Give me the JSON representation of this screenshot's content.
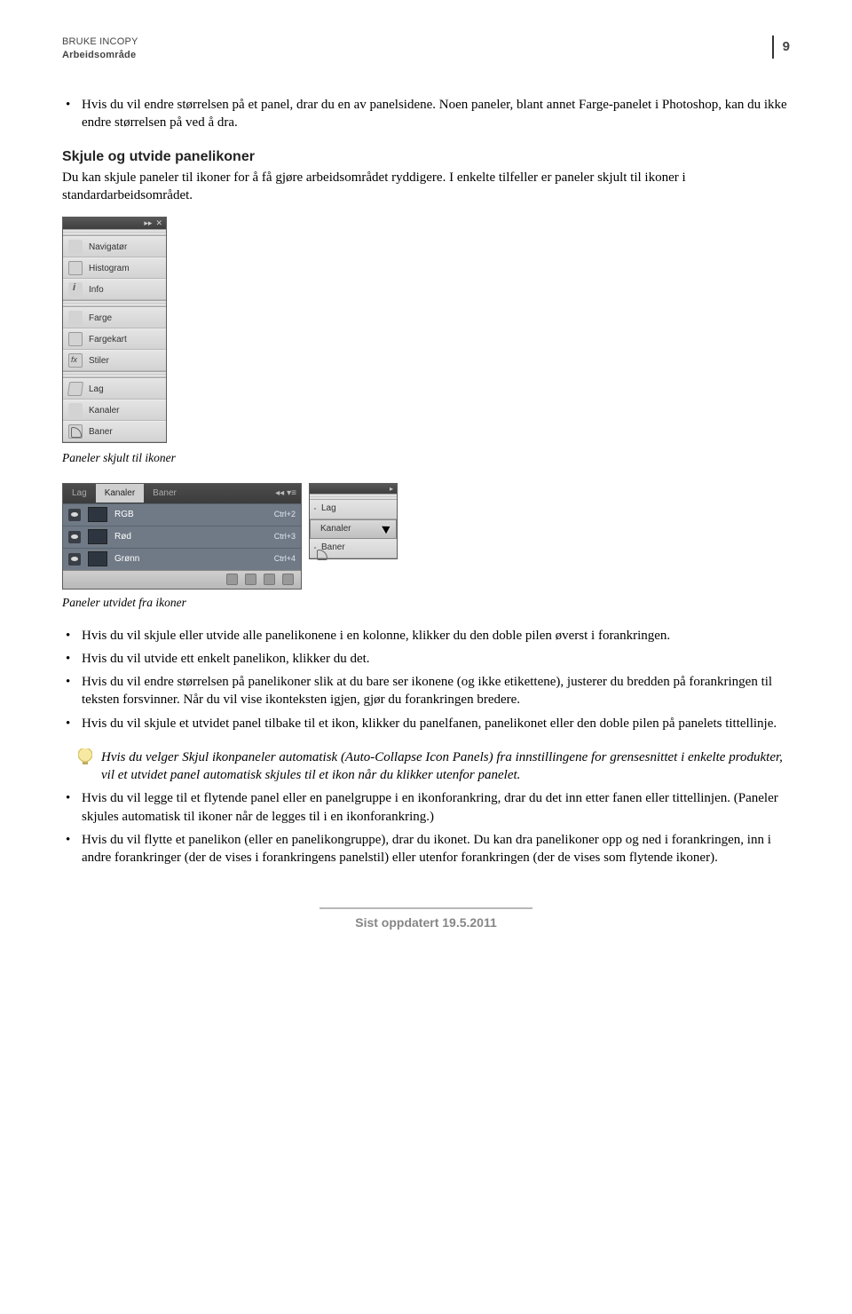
{
  "header": {
    "line1": "BRUKE INCOPY",
    "line2": "Arbeidsområde",
    "page_number": "9"
  },
  "intro_bullet": "Hvis du vil endre størrelsen på et panel, drar du en av panelsidene. Noen paneler, blant annet Farge-panelet i Photoshop, kan du ikke endre størrelsen på ved å dra.",
  "section1": {
    "heading": "Skjule og utvide panelikoner",
    "body": "Du kan skjule paneler til ikoner for å få gjøre arbeidsområdet ryddigere. I enkelte tilfeller er paneler skjult til ikoner i standardarbeidsområdet."
  },
  "panel_dock": {
    "groups": [
      [
        {
          "icon": "ic-nav",
          "name": "navigator-icon",
          "label": "Navigatør"
        },
        {
          "icon": "ic-hist",
          "name": "histogram-icon",
          "label": "Histogram"
        },
        {
          "icon": "ic-info",
          "name": "info-icon",
          "label": "Info"
        }
      ],
      [
        {
          "icon": "ic-color",
          "name": "color-icon",
          "label": "Farge"
        },
        {
          "icon": "ic-swatch",
          "name": "swatches-icon",
          "label": "Fargekart"
        },
        {
          "icon": "ic-styles",
          "name": "styles-icon",
          "label": "Stiler"
        }
      ],
      [
        {
          "icon": "ic-layers",
          "name": "layers-icon",
          "label": "Lag"
        },
        {
          "icon": "ic-channels",
          "name": "channels-icon",
          "label": "Kanaler"
        },
        {
          "icon": "ic-paths",
          "name": "paths-icon",
          "label": "Baner"
        }
      ]
    ]
  },
  "caption1": "Paneler skjult til ikoner",
  "expanded": {
    "tabs": [
      "Lag",
      "Kanaler",
      "Baner"
    ],
    "active_tab_index": 1,
    "rows": [
      {
        "label": "RGB",
        "shortcut": "Ctrl+2"
      },
      {
        "label": "Rød",
        "shortcut": "Ctrl+3"
      },
      {
        "label": "Grønn",
        "shortcut": "Ctrl+4"
      }
    ],
    "mini_dock": [
      {
        "icon": "ic-layers",
        "name": "layers-icon",
        "label": "Lag",
        "selected": false
      },
      {
        "icon": "ic-channels",
        "name": "channels-icon",
        "label": "Kanaler",
        "selected": true
      },
      {
        "icon": "ic-paths",
        "name": "paths-icon",
        "label": "Baner",
        "selected": false
      }
    ]
  },
  "caption2": "Paneler utvidet fra ikoner",
  "bullets2": [
    "Hvis du vil skjule eller utvide alle panelikonene i en kolonne, klikker du den doble pilen øverst i forankringen.",
    "Hvis du vil utvide ett enkelt panelikon, klikker du det.",
    "Hvis du vil endre størrelsen på panelikoner slik at du bare ser ikonene (og ikke etikettene), justerer du bredden på forankringen til teksten forsvinner. Når du vil vise ikonteksten igjen, gjør du forankringen bredere.",
    "Hvis du vil skjule et utvidet panel tilbake til et ikon, klikker du panelfanen, panelikonet eller den doble pilen på panelets tittellinje."
  ],
  "tip": "Hvis du velger Skjul ikonpaneler automatisk (Auto-Collapse Icon Panels) fra innstillingene for grensesnittet i enkelte produkter, vil et utvidet panel automatisk skjules til et ikon når du klikker utenfor panelet.",
  "bullets3": [
    "Hvis du vil legge til et flytende panel eller en panelgruppe i en ikonforankring, drar du det inn etter fanen eller tittellinjen. (Paneler skjules automatisk til ikoner når de legges til i en ikonforankring.)",
    "Hvis du vil flytte et panelikon (eller en panelikongruppe), drar du ikonet. Du kan dra panelikoner opp og ned i forankringen, inn i andre forankringer (der de vises i forankringens panelstil) eller utenfor forankringen (der de vises som flytende ikoner)."
  ],
  "footer": "Sist oppdatert 19.5.2011"
}
